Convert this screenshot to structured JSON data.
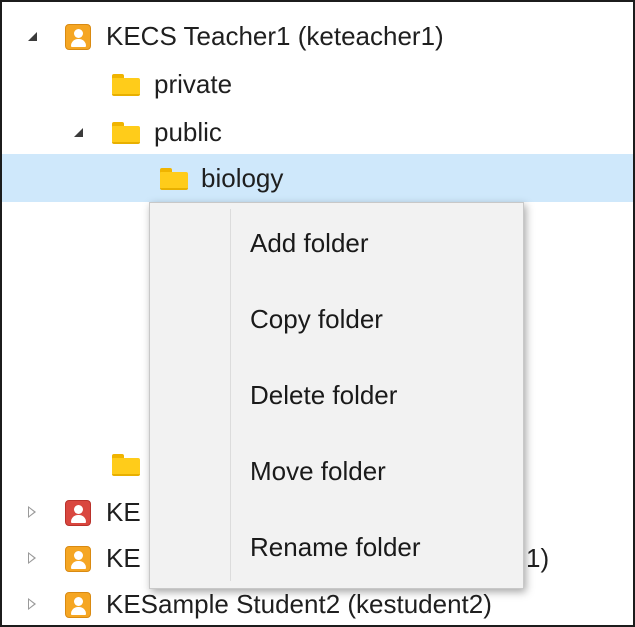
{
  "tree": {
    "rows": [
      {
        "label": "KECS Teacher1 (keteacher1)"
      },
      {
        "label": "private"
      },
      {
        "label": "public"
      },
      {
        "label": "biology"
      },
      {
        "label": ""
      },
      {
        "label": "KE"
      },
      {
        "label": "KE"
      },
      {
        "label": "KESample Student2 (kestudent2)"
      }
    ],
    "partial_tail": "1)"
  },
  "context_menu": {
    "items": [
      {
        "label": "Add folder"
      },
      {
        "label": "Copy folder"
      },
      {
        "label": "Delete folder"
      },
      {
        "label": "Move folder"
      },
      {
        "label": "Rename folder"
      }
    ]
  },
  "colors": {
    "selection": "#cfe8fb",
    "folder": "#ffcc1a",
    "user_orange": "#f5a623",
    "user_red": "#d9473f",
    "menu_bg": "#f2f2f2"
  },
  "icons": {
    "expanded": "triangle-down-icon",
    "collapsed": "triangle-right-icon",
    "folder": "folder-icon",
    "user": "user-icon"
  }
}
